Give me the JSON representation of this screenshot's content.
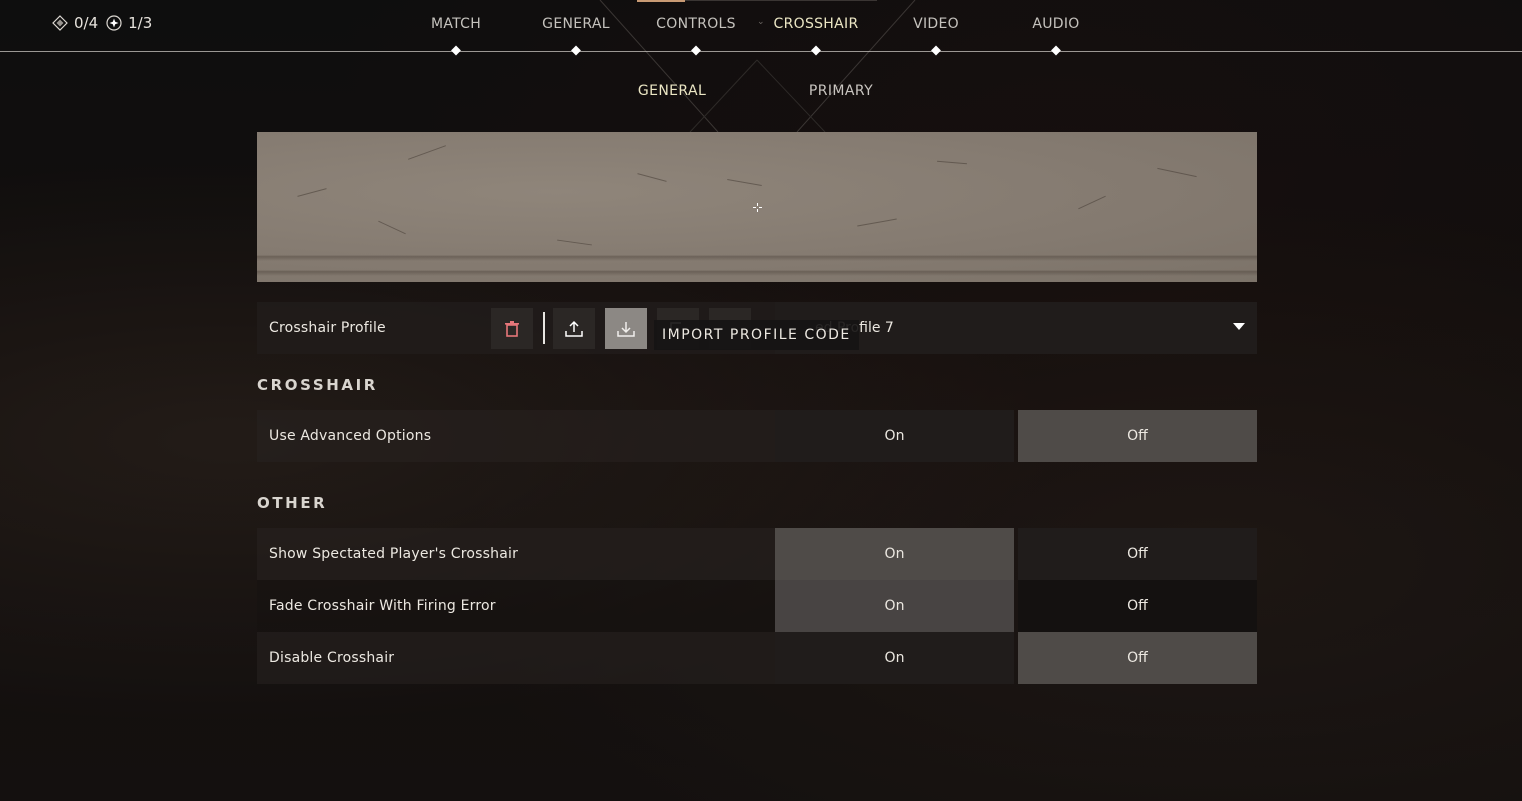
{
  "header": {
    "counters": [
      {
        "icon": "diamond-badge-icon",
        "value": "0/4"
      },
      {
        "icon": "star-circle-icon",
        "value": "1/3"
      }
    ],
    "tabs": [
      {
        "label": "MATCH",
        "active": false
      },
      {
        "label": "GENERAL",
        "active": false
      },
      {
        "label": "CONTROLS",
        "active": false
      },
      {
        "label": "CROSSHAIR",
        "active": true
      },
      {
        "label": "VIDEO",
        "active": false
      },
      {
        "label": "AUDIO",
        "active": false
      }
    ],
    "sub_tabs": [
      {
        "label": "GENERAL",
        "active": true
      },
      {
        "label": "PRIMARY",
        "active": false
      }
    ]
  },
  "profile": {
    "label": "Crosshair Profile",
    "buttons": [
      {
        "name": "delete",
        "icon": "trash-icon"
      },
      {
        "name": "export",
        "icon": "upload-icon"
      },
      {
        "name": "import",
        "icon": "download-icon"
      },
      {
        "name": "copy",
        "icon": "copy-icon"
      },
      {
        "name": "more",
        "icon": "blank-icon"
      }
    ],
    "tooltip": "IMPORT PROFILE CODE",
    "selected_visible_text": "ed Profile 7"
  },
  "sections": [
    {
      "title": "CROSSHAIR",
      "rows": [
        {
          "label": "Use Advanced Options",
          "on_label": "On",
          "off_label": "Off",
          "value": "Off"
        }
      ]
    },
    {
      "title": "OTHER",
      "rows": [
        {
          "label": "Show Spectated Player's Crosshair",
          "on_label": "On",
          "off_label": "Off",
          "value": "On"
        },
        {
          "label": "Fade Crosshair With Firing Error",
          "on_label": "On",
          "off_label": "Off",
          "value": "On"
        },
        {
          "label": "Disable Crosshair",
          "on_label": "On",
          "off_label": "Off",
          "value": "Off"
        }
      ]
    }
  ],
  "colors": {
    "active_tab": "#ebe6c4",
    "accent_bar": "#c89a74",
    "delete_icon": "#e6767a",
    "selected_option": "#4f4b48"
  }
}
